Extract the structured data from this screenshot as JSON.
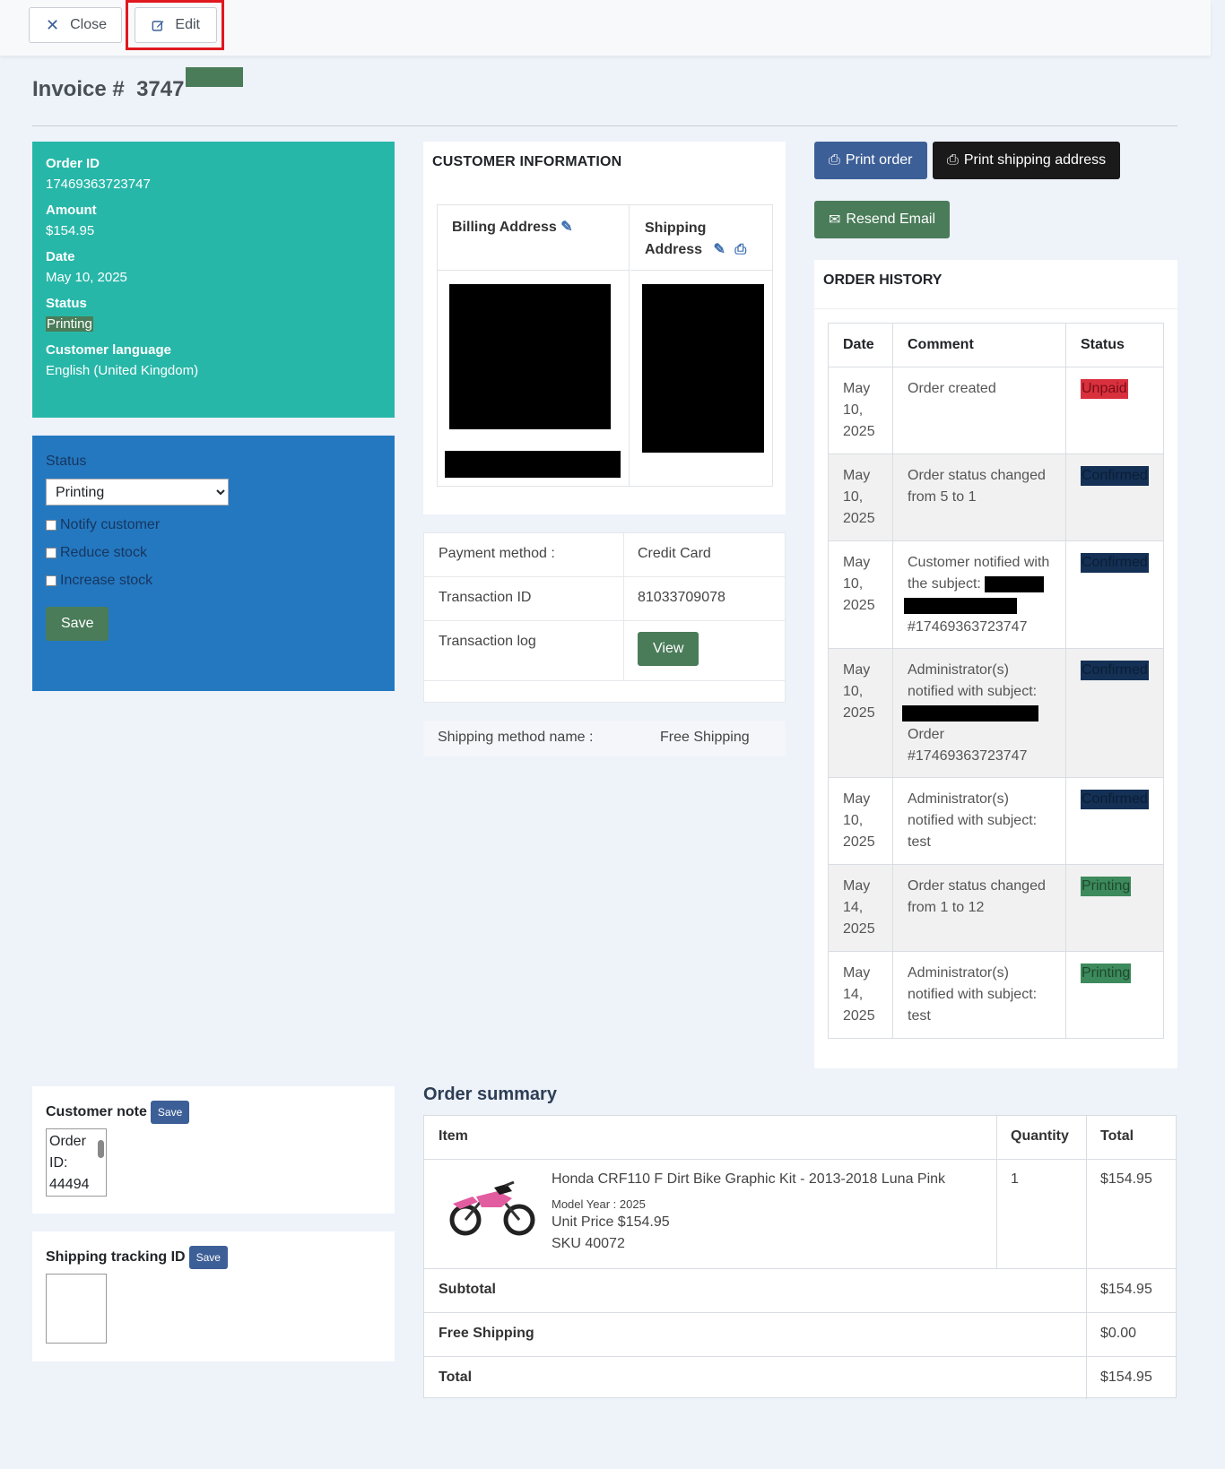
{
  "toolbar": {
    "close_label": "Close",
    "edit_label": "Edit"
  },
  "invoice": {
    "prefix": "Invoice #",
    "number": "3747"
  },
  "order_info": {
    "order_id_label": "Order ID",
    "order_id": "17469363723747",
    "amount_label": "Amount",
    "amount": "$154.95",
    "date_label": "Date",
    "date": "May 10, 2025",
    "status_label": "Status",
    "status": "Printing",
    "language_label": "Customer language",
    "language": "English (United Kingdom)"
  },
  "status_form": {
    "label": "Status",
    "selected": "Printing",
    "notify": "Notify customer",
    "reduce": "Reduce stock",
    "increase": "Increase stock",
    "save": "Save"
  },
  "customer": {
    "title": "CUSTOMER INFORMATION",
    "billing": "Billing Address",
    "shipping_line1": "Shipping",
    "shipping_line2": "Address"
  },
  "payment": {
    "method_label": "Payment method :",
    "method": "Credit Card",
    "txid_label": "Transaction ID",
    "txid": "81033709078",
    "log_label": "Transaction log",
    "view": "View"
  },
  "shipping": {
    "label": "Shipping method name :",
    "value": "Free Shipping"
  },
  "actions": {
    "print_order": "Print order",
    "print_shipping": "Print shipping address",
    "resend": "Resend Email"
  },
  "history": {
    "title": "ORDER HISTORY",
    "headers": [
      "Date",
      "Comment",
      "Status"
    ],
    "rows": [
      {
        "d1": "May",
        "d2": "10,",
        "d3": "2025",
        "comment": "Order created",
        "status": "Unpaid"
      },
      {
        "d1": "May",
        "d2": "10,",
        "d3": "2025",
        "comment": "Order status changed from 5 to 1",
        "status": "Confirmed"
      },
      {
        "d1": "May",
        "d2": "10,",
        "d3": "2025",
        "c1": "Customer notified with",
        "c2": "the subject:",
        "c3": "#17469363723747",
        "status": "Confirmed"
      },
      {
        "d1": "May",
        "d2": "10,",
        "d3": "2025",
        "c1": "Administrator(s)",
        "c2": "notified with subject:",
        "c3": "Order",
        "c4": "#17469363723747",
        "status": "Confirmed"
      },
      {
        "d1": "May",
        "d2": "10,",
        "d3": "2025",
        "comment": "Administrator(s) notified with subject: test",
        "status": "Confirmed"
      },
      {
        "d1": "May",
        "d2": "14,",
        "d3": "2025",
        "comment": "Order status changed from 1 to 12",
        "status": "Printing"
      },
      {
        "d1": "May",
        "d2": "14,",
        "d3": "2025",
        "comment": "Administrator(s) notified with subject: test",
        "status": "Printing"
      }
    ]
  },
  "customer_note": {
    "label": "Customer note",
    "save": "Save",
    "l1": "Order",
    "l2": "ID:",
    "l3": "44494"
  },
  "tracking": {
    "label": "Shipping tracking ID",
    "save": "Save"
  },
  "summary": {
    "title": "Order summary",
    "h_item": "Item",
    "h_qty": "Quantity",
    "h_total": "Total",
    "item_name": "Honda CRF110 F Dirt Bike Graphic Kit - 2013-2018 Luna Pink",
    "model_year": "Model Year : 2025",
    "unit_price": "Unit Price $154.95",
    "sku": "SKU 40072",
    "qty": "1",
    "item_total": "$154.95",
    "subtotal_label": "Subtotal",
    "subtotal": "$154.95",
    "shipping_label": "Free Shipping",
    "shipping": "$0.00",
    "total_label": "Total",
    "total": "$154.95"
  }
}
